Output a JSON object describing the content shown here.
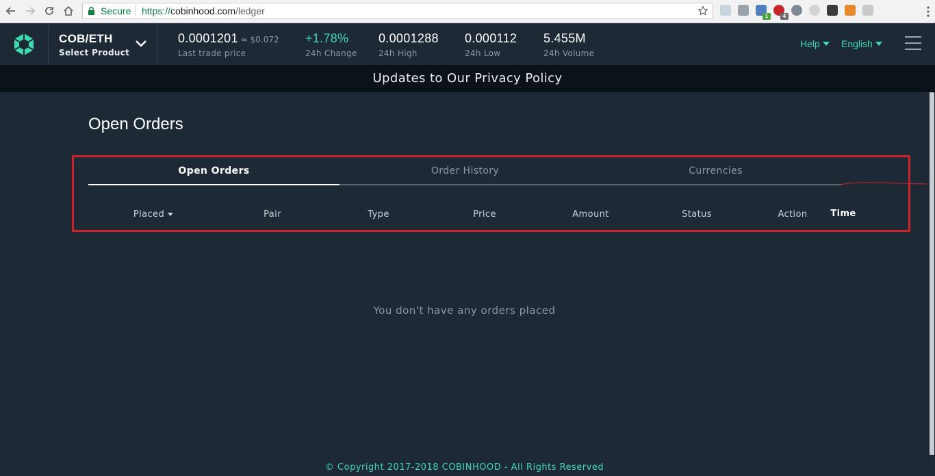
{
  "browser": {
    "secure_label": "Secure",
    "url_proto": "https://",
    "url_domain": "cobinhood.com",
    "url_path": "/ledger",
    "ext_badges": [
      "1",
      "4"
    ]
  },
  "header": {
    "product_name": "COB/ETH",
    "product_sub": "Select Product",
    "last_price": "0.0001201",
    "last_price_usd": "≈ $0.072",
    "last_price_label": "Last trade price",
    "change": "+1.78%",
    "change_label": "24h Change",
    "high": "0.0001288",
    "high_label": "24h High",
    "low": "0.000112",
    "low_label": "24h Low",
    "volume": "5.455M",
    "volume_label": "24h Volume",
    "help_label": "Help",
    "language_label": "English"
  },
  "banner": {
    "text": "Updates to Our Privacy Policy"
  },
  "main": {
    "title": "Open Orders",
    "tabs": [
      {
        "label": "Open Orders",
        "active": true
      },
      {
        "label": "Order History",
        "active": false
      },
      {
        "label": "Currencies",
        "active": false
      }
    ],
    "columns": [
      "Placed",
      "Pair",
      "Type",
      "Price",
      "Amount",
      "Status",
      "Action",
      "Time"
    ],
    "empty_message": "You don't have any orders placed"
  },
  "footer": {
    "text": "© Copyright 2017-2018 COBINHOOD - All Rights Reserved"
  },
  "colors": {
    "accent": "#3ed9b0",
    "background": "#1d2a36",
    "banner": "#0b1319",
    "highlight": "#d0212a"
  }
}
